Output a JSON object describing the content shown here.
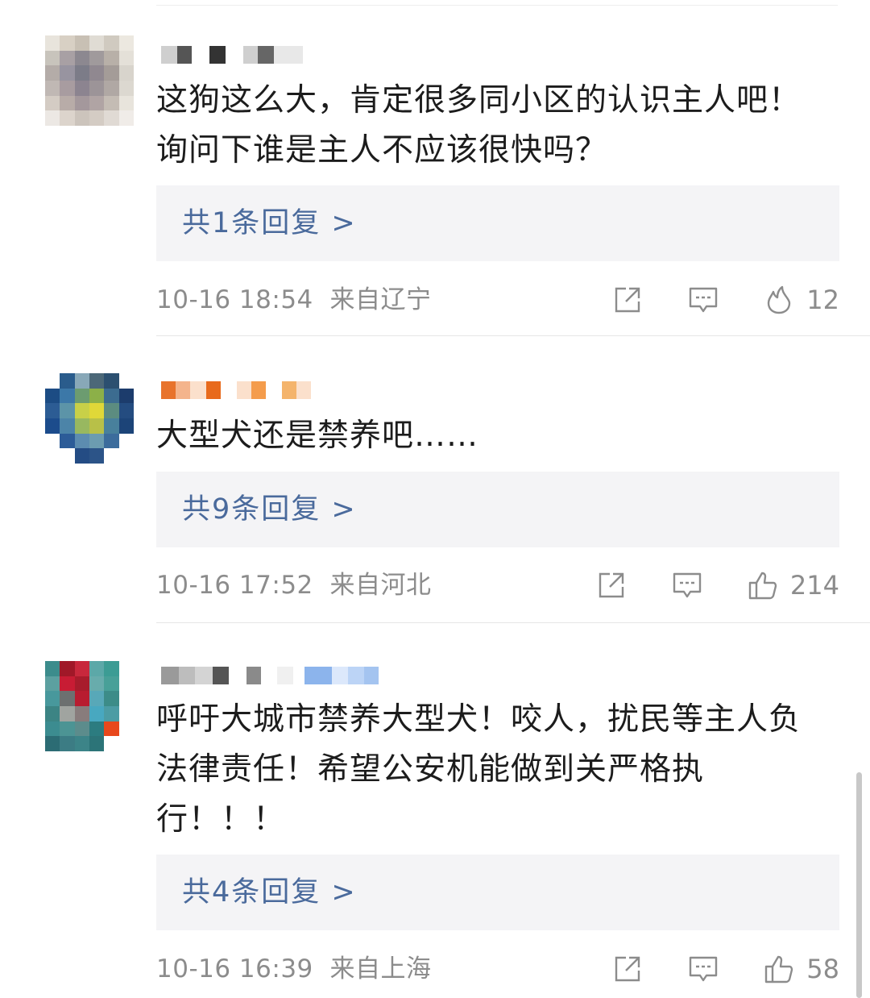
{
  "comments": [
    {
      "text": "这狗这么大，肯定很多同小区的认识主人吧！\n询问下谁是主人不应该很快吗？",
      "reply_label": "共1条回复 >",
      "time": "10-16 18:54",
      "location": "来自辽宁",
      "reaction_icon": "fire-icon",
      "count": "12",
      "avatar_colors": [
        "#e8e4dc",
        "#d8d0c4",
        "#c8c0b4",
        "#e0dcd4",
        "#d0cac0",
        "#ece8e0",
        "#c8c4bc",
        "#a8a0a4",
        "#8c8890",
        "#a09a9c",
        "#b8b0a8",
        "#e4e0d8",
        "#b4aca8",
        "#9894a0",
        "#7c7c88",
        "#908890",
        "#a49c98",
        "#d8d4cc",
        "#c0b8b4",
        "#a89ca0",
        "#8c8490",
        "#9c9498",
        "#b0a8a4",
        "#dcd8d0",
        "#d4ccc4",
        "#b8aca8",
        "#a4989c",
        "#b0a4a4",
        "#c4bcb4",
        "#e8e4dc",
        "#ece8e4",
        "#dcd4cc",
        "#ccc4bc",
        "#d4ccc4",
        "#e0dad4",
        "#f0ece8"
      ]
    },
    {
      "text": "大型犬还是禁养吧……",
      "reply_label": "共9条回复 >",
      "time": "10-16 17:52",
      "location": "来自河北",
      "reaction_icon": "thumbs-up-icon",
      "count": "214",
      "avatar_colors": [
        "#ffffff",
        "#2a5c8c",
        "#88a8b8",
        "#4c6878",
        "#2c5070",
        "#ffffff",
        "#1c4c84",
        "#3c78a8",
        "#6c9c70",
        "#8cb048",
        "#3c6c90",
        "#1c3c6c",
        "#2c5c94",
        "#5c94a8",
        "#c8d048",
        "#e0d838",
        "#5c8c80",
        "#244c80",
        "#1c4c8c",
        "#4c84a8",
        "#98b860",
        "#b8c048",
        "#48809c",
        "#1c4478",
        "#ffffff",
        "#2c5c98",
        "#5c8cb0",
        "#6c9cb0",
        "#3c6c9c",
        "#ffffff",
        "#ffffff",
        "#ffffff",
        "#244c84",
        "#2c5488",
        "#ffffff",
        "#ffffff"
      ]
    },
    {
      "text": "呼吁大城市禁养大型犬！咬人，扰民等主人负\n法律责任！希望公安机能做到关严格执\n行！！！",
      "reply_label": "共4条回复 >",
      "time": "10-16 16:39",
      "location": "来自上海",
      "reaction_icon": "thumbs-up-icon",
      "count": "58",
      "avatar_colors": [
        "#3c8c8c",
        "#a01828",
        "#c8283c",
        "#5ca8a8",
        "#3c9c94",
        "#ffffff",
        "#5ca0a0",
        "#c81c34",
        "#a81c2c",
        "#68acac",
        "#48a098",
        "#ffffff",
        "#48989c",
        "#6c7070",
        "#b81c30",
        "#58a8b8",
        "#3c8c88",
        "#ffffff",
        "#3c8484",
        "#a0a4a0",
        "#887c7c",
        "#48a8c0",
        "#4c9ca4",
        "#ffffff",
        "#3c8c90",
        "#4c9494",
        "#5c8c8c",
        "#2c7c80",
        "#e8481c",
        "#ffffff",
        "#2c6c74",
        "#3c7c84",
        "#3c8488",
        "#2c7478",
        "#ffffff",
        "#ffffff"
      ]
    }
  ],
  "colors": {
    "reply_link": "#4a6a9c",
    "meta_text": "#8c8c8c",
    "reply_bg": "#f4f4f6"
  },
  "icons": {
    "share": "share-icon",
    "comment": "comment-icon"
  }
}
